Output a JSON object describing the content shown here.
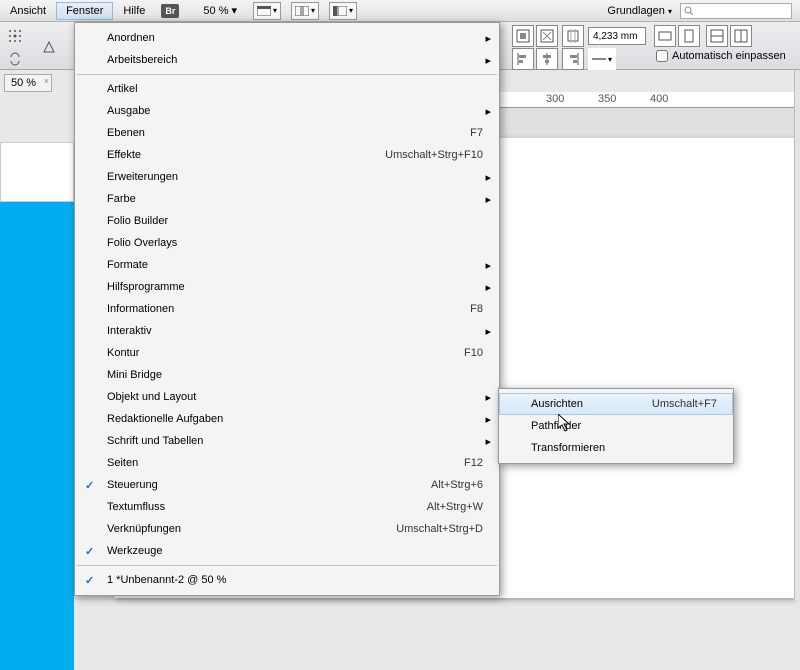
{
  "menubar": {
    "items": [
      "Ansicht",
      "Fenster",
      "Hilfe"
    ],
    "active_index": 1,
    "br_label": "Br",
    "zoom": "50 % ▾",
    "workspace_label": "Grundlagen",
    "search_placeholder": ""
  },
  "controlbar": {
    "value_mm": "4,233 mm",
    "autofit_label": "Automatisch einpassen"
  },
  "leftpanel": {
    "tab_label": "50 %"
  },
  "ruler": {
    "marks": [
      "300",
      "350",
      "400"
    ]
  },
  "menu": {
    "items": [
      {
        "label": "Anordnen",
        "arrow": true
      },
      {
        "label": "Arbeitsbereich",
        "arrow": true
      },
      {
        "sep": true
      },
      {
        "label": "Artikel"
      },
      {
        "label": "Ausgabe",
        "arrow": true
      },
      {
        "label": "Ebenen",
        "shortcut": "F7"
      },
      {
        "label": "Effekte",
        "shortcut": "Umschalt+Strg+F10"
      },
      {
        "label": "Erweiterungen",
        "arrow": true
      },
      {
        "label": "Farbe",
        "arrow": true
      },
      {
        "label": "Folio Builder"
      },
      {
        "label": "Folio Overlays"
      },
      {
        "label": "Formate",
        "arrow": true
      },
      {
        "label": "Hilfsprogramme",
        "arrow": true
      },
      {
        "label": "Informationen",
        "shortcut": "F8"
      },
      {
        "label": "Interaktiv",
        "arrow": true
      },
      {
        "label": "Kontur",
        "shortcut": "F10"
      },
      {
        "label": "Mini Bridge"
      },
      {
        "label": "Objekt und Layout",
        "arrow": true
      },
      {
        "label": "Redaktionelle Aufgaben",
        "arrow": true
      },
      {
        "label": "Schrift und Tabellen",
        "arrow": true
      },
      {
        "label": "Seiten",
        "shortcut": "F12"
      },
      {
        "label": "Steuerung",
        "shortcut": "Alt+Strg+6",
        "check": true
      },
      {
        "label": "Textumfluss",
        "shortcut": "Alt+Strg+W"
      },
      {
        "label": "Verknüpfungen",
        "shortcut": "Umschalt+Strg+D"
      },
      {
        "label": "Werkzeuge",
        "check": true
      },
      {
        "sep": true
      },
      {
        "label": "1 *Unbenannt-2 @ 50 %",
        "check": true
      }
    ]
  },
  "submenu": {
    "items": [
      {
        "label": "Ausrichten",
        "shortcut": "Umschalt+F7",
        "hovered": true
      },
      {
        "label": "Pathfinder"
      },
      {
        "label": "Transformieren"
      }
    ]
  }
}
